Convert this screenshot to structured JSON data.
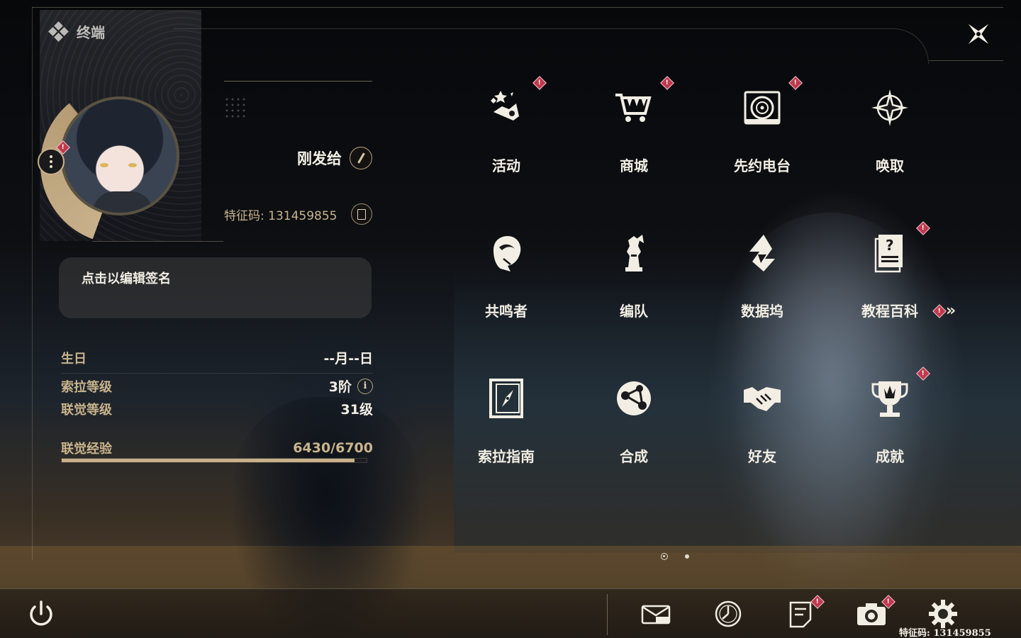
{
  "header": {
    "title": "终端"
  },
  "profile": {
    "name": "刚发给",
    "id_label": "特征码: ",
    "id_value": "131459855",
    "signature_placeholder": "点击以编辑签名"
  },
  "info": {
    "birthday_label": "生日",
    "birthday_value": "--月--日",
    "sol_level_label": "索拉等级",
    "sol_level_value": "3阶",
    "union_level_label": "联觉等级",
    "union_level_value": "31级",
    "exp_label": "联觉经验",
    "exp_value": "6430/6700",
    "exp_progress": 0.9597
  },
  "grid": {
    "items": [
      {
        "label": "活动",
        "icon": "event-stars-icon",
        "badge": true
      },
      {
        "label": "商城",
        "icon": "shop-cart-icon",
        "badge": true
      },
      {
        "label": "先约电台",
        "icon": "radio-icon",
        "badge": true
      },
      {
        "label": "唤取",
        "icon": "convene-star-icon",
        "badge": false
      },
      {
        "label": "共鸣者",
        "icon": "resonator-icon",
        "badge": false
      },
      {
        "label": "编队",
        "icon": "team-chess-icon",
        "badge": false
      },
      {
        "label": "数据坞",
        "icon": "data-bank-icon",
        "badge": false
      },
      {
        "label": "教程百科",
        "icon": "tutorial-book-icon",
        "badge": true
      },
      {
        "label": "索拉指南",
        "icon": "guidebook-compass-icon",
        "badge": false
      },
      {
        "label": "合成",
        "icon": "synthesis-icon",
        "badge": false
      },
      {
        "label": "好友",
        "icon": "handshake-icon",
        "badge": false
      },
      {
        "label": "成就",
        "icon": "trophy-icon",
        "badge": true
      }
    ],
    "badge_glyph": "!",
    "more_glyph": "»",
    "pages": 2,
    "current_page": 1
  },
  "bottom_bar": {
    "id_text": "特征码: 131459855",
    "icons": [
      "power-icon",
      "mail-icon",
      "clock-icon",
      "notice-icon",
      "camera-icon",
      "settings-gear-icon"
    ]
  },
  "colors": {
    "accent_gold": "#c7b08a",
    "badge_red": "#c0394f",
    "text_light": "#f2eee4"
  }
}
